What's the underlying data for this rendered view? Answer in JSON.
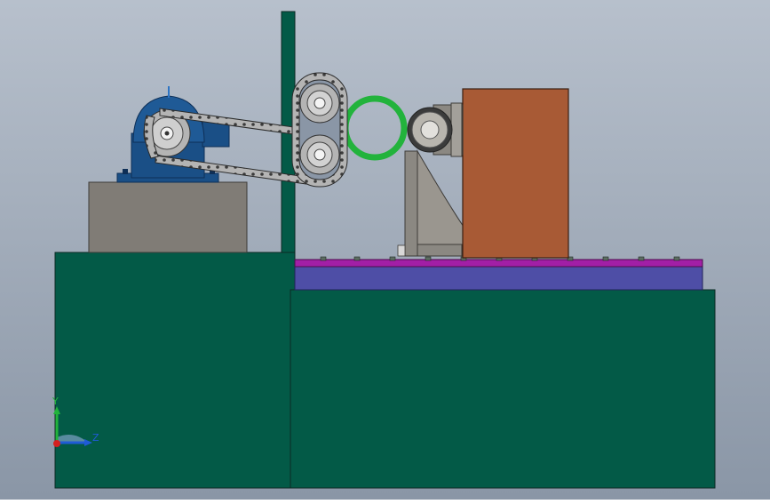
{
  "scene": {
    "background_top": "#b7c0cc",
    "background_bottom": "#8a96a6"
  },
  "colors": {
    "frame_green": "#035a47",
    "frame_edge": "#0d2a24",
    "motor_blue": "#1a4f86",
    "motor_dark": "#0e2f57",
    "platform_gray": "#807c76",
    "chain_gray": "#b4b4b4",
    "ring_green": "#22b33c",
    "block_orange": "#a85a35",
    "bracket_gray": "#8b8882",
    "rail_magenta": "#a21fa6",
    "table_purple": "#4e4ea6"
  },
  "triad": {
    "y_label": "Y",
    "z_label": "Z",
    "y_color": "#22b33c",
    "z_color": "#1f5bd6",
    "x_color": "#d42020"
  },
  "icons": {
    "triad": "coordinate-triad-icon"
  }
}
